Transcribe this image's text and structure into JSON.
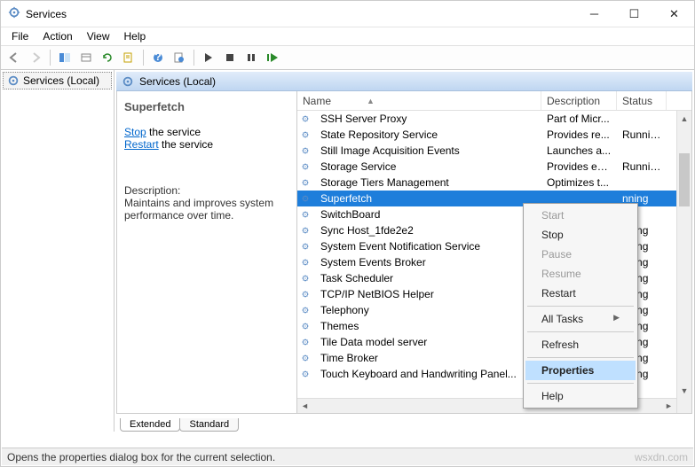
{
  "window": {
    "title": "Services"
  },
  "menus": {
    "file": "File",
    "action": "Action",
    "view": "View",
    "help": "Help"
  },
  "left": {
    "node": "Services (Local)"
  },
  "paneheader": {
    "title": "Services (Local)"
  },
  "detail": {
    "title": "Superfetch",
    "stop": "Stop",
    "stop_suffix": " the service",
    "restart": "Restart",
    "restart_suffix": " the service",
    "desc_label": "Description:",
    "desc_text": "Maintains and improves system performance over time."
  },
  "columns": {
    "name": "Name",
    "desc": "Description",
    "status": "Status"
  },
  "services": [
    {
      "name": "SSH Server Proxy",
      "desc": "Part of Micr...",
      "status": ""
    },
    {
      "name": "State Repository Service",
      "desc": "Provides re...",
      "status": "Running"
    },
    {
      "name": "Still Image Acquisition Events",
      "desc": "Launches a...",
      "status": ""
    },
    {
      "name": "Storage Service",
      "desc": "Provides en...",
      "status": "Running"
    },
    {
      "name": "Storage Tiers Management",
      "desc": "Optimizes t...",
      "status": ""
    },
    {
      "name": "Superfetch",
      "desc": "",
      "status": "nning",
      "selected": true
    },
    {
      "name": "SwitchBoard",
      "desc": "",
      "status": ""
    },
    {
      "name": "Sync Host_1fde2e2",
      "desc": "",
      "status": "nning"
    },
    {
      "name": "System Event Notification Service",
      "desc": "",
      "status": "nning"
    },
    {
      "name": "System Events Broker",
      "desc": "",
      "status": "nning"
    },
    {
      "name": "Task Scheduler",
      "desc": "",
      "status": "nning"
    },
    {
      "name": "TCP/IP NetBIOS Helper",
      "desc": "",
      "status": "nning"
    },
    {
      "name": "Telephony",
      "desc": "",
      "status": "nning"
    },
    {
      "name": "Themes",
      "desc": "",
      "status": "nning"
    },
    {
      "name": "Tile Data model server",
      "desc": "",
      "status": "nning"
    },
    {
      "name": "Time Broker",
      "desc": "",
      "status": "nning"
    },
    {
      "name": "Touch Keyboard and Handwriting Panel...",
      "desc": "",
      "status": "nning"
    }
  ],
  "context": {
    "start": "Start",
    "stop": "Stop",
    "pause": "Pause",
    "resume": "Resume",
    "restart": "Restart",
    "alltasks": "All Tasks",
    "refresh": "Refresh",
    "properties": "Properties",
    "help": "Help"
  },
  "tabs": {
    "extended": "Extended",
    "standard": "Standard"
  },
  "statusbar": {
    "text": "Opens the properties dialog box for the current selection.",
    "watermark": "wsxdn.com"
  }
}
